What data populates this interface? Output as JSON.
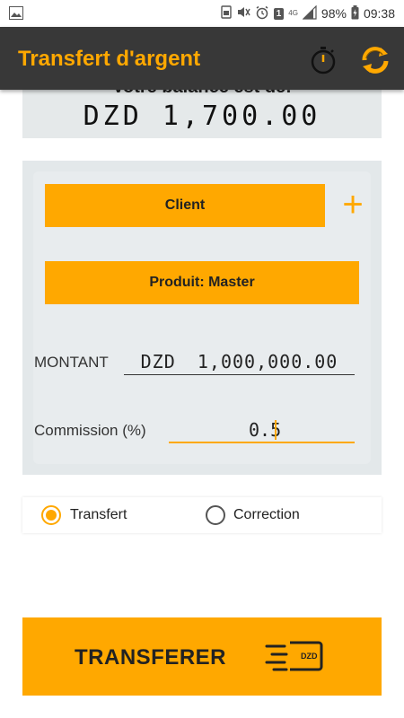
{
  "status_bar": {
    "battery": "98%",
    "time": "09:38",
    "notification_badge": "1",
    "network": "4G",
    "icons": [
      "gallery-icon",
      "storage-icon",
      "mute-icon",
      "alarm-icon",
      "signal-icon",
      "battery-icon"
    ]
  },
  "app_bar": {
    "title": "Transfert d'argent",
    "icons": [
      "timer-icon",
      "refresh-icon"
    ]
  },
  "balance": {
    "label": "Votre balance est de:",
    "value": "DZD  1,700.00"
  },
  "form": {
    "client_button": "Client",
    "add_icon": "+",
    "produit_button": "Produit: Master",
    "montant_label": "MONTANT",
    "montant_currency": "DZD",
    "montant_value": "1,000,000.00",
    "commission_label": "Commission (%)",
    "commission_value": "0.5"
  },
  "transfer_type": {
    "options": [
      {
        "label": "Transfert",
        "selected": true
      },
      {
        "label": "Correction",
        "selected": false
      }
    ]
  },
  "action": {
    "label": "TRANSFERER",
    "icon": "fast-transfer-icon",
    "icon_text": "DZD"
  },
  "colors": {
    "accent": "#ffa800",
    "app_bar": "#383838",
    "card": "#e3e8ea"
  }
}
